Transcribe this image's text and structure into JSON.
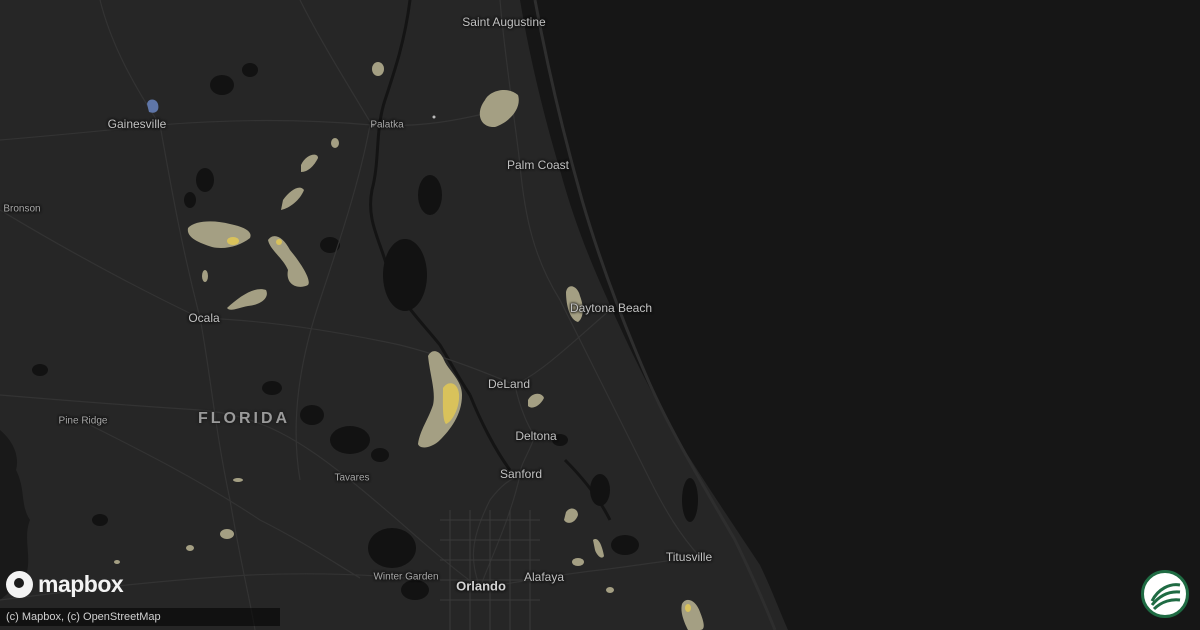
{
  "map": {
    "state_label": "FLORIDA",
    "places": [
      {
        "name": "Saint Augustine",
        "size": "normal"
      },
      {
        "name": "Gainesville",
        "size": "normal"
      },
      {
        "name": "Palatka",
        "size": "small"
      },
      {
        "name": "Palm Coast",
        "size": "normal"
      },
      {
        "name": "Bronson",
        "size": "small"
      },
      {
        "name": "Ocala",
        "size": "normal"
      },
      {
        "name": "Daytona Beach",
        "size": "normal"
      },
      {
        "name": "DeLand",
        "size": "normal"
      },
      {
        "name": "Pine Ridge",
        "size": "small"
      },
      {
        "name": "Deltona",
        "size": "normal"
      },
      {
        "name": "Sanford",
        "size": "normal"
      },
      {
        "name": "Tavares",
        "size": "small"
      },
      {
        "name": "Titusville",
        "size": "normal"
      },
      {
        "name": "Winter Garden",
        "size": "small"
      },
      {
        "name": "Orlando",
        "size": "big"
      },
      {
        "name": "Alafaya",
        "size": "normal"
      }
    ],
    "colors": {
      "land": "#262626",
      "water": "#161616",
      "lake": "#121212",
      "road": "#353535",
      "storm_light": "#a49f83",
      "storm_core": "#d9c25b",
      "storm_blue": "#5f76a8"
    }
  },
  "branding": {
    "logo_text": "mapbox",
    "attribution": "(c) Mapbox, (c) OpenStreetMap"
  }
}
